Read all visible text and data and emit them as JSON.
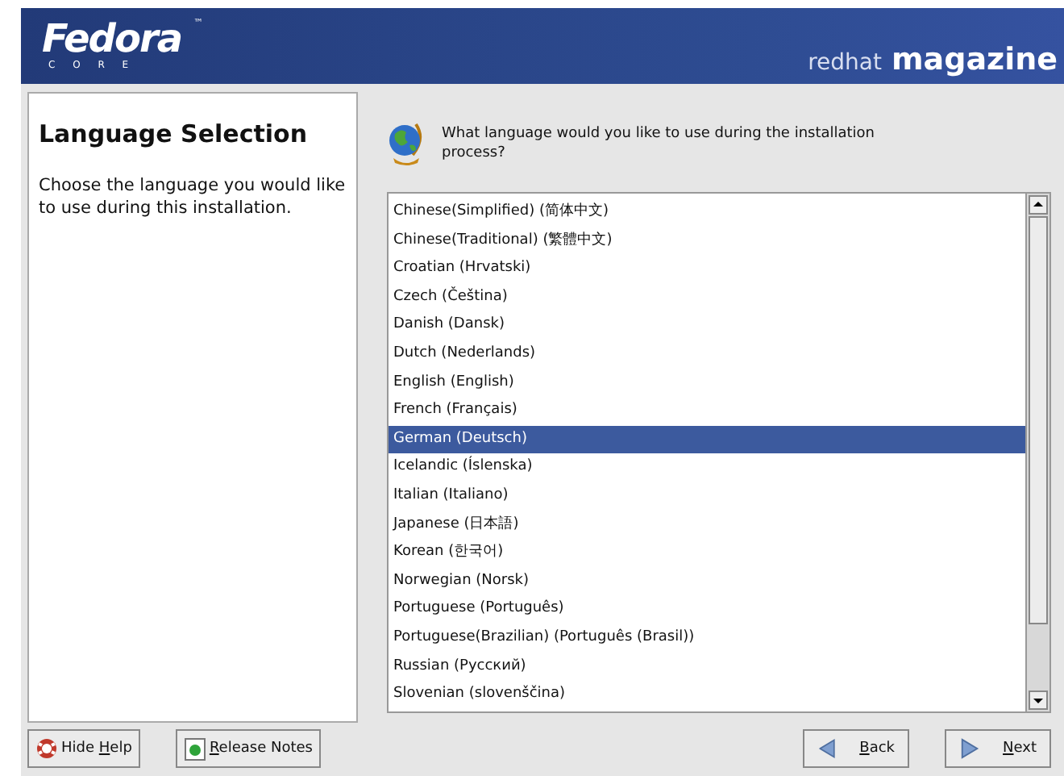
{
  "header": {
    "logo": "Fedora",
    "logo_tm": "™",
    "logo_sub": "C O R E",
    "brand_light": "redhat",
    "brand_bold": "magazine"
  },
  "help": {
    "title": "Language Selection",
    "text": "Choose the language you would like to use during this installation."
  },
  "question": "What language would you like to use during the installation process?",
  "languages": [
    {
      "label": "Chinese(Simplified) (简体中文)",
      "selected": false
    },
    {
      "label": "Chinese(Traditional) (繁體中文)",
      "selected": false
    },
    {
      "label": "Croatian (Hrvatski)",
      "selected": false
    },
    {
      "label": "Czech (Čeština)",
      "selected": false
    },
    {
      "label": "Danish (Dansk)",
      "selected": false
    },
    {
      "label": "Dutch (Nederlands)",
      "selected": false
    },
    {
      "label": "English (English)",
      "selected": false
    },
    {
      "label": "French (Français)",
      "selected": false
    },
    {
      "label": "German (Deutsch)",
      "selected": true
    },
    {
      "label": "Icelandic (Íslenska)",
      "selected": false
    },
    {
      "label": "Italian (Italiano)",
      "selected": false
    },
    {
      "label": "Japanese (日本語)",
      "selected": false
    },
    {
      "label": "Korean (한국어)",
      "selected": false
    },
    {
      "label": "Norwegian (Norsk)",
      "selected": false
    },
    {
      "label": "Portuguese (Português)",
      "selected": false
    },
    {
      "label": "Portuguese(Brazilian) (Português (Brasil))",
      "selected": false
    },
    {
      "label": "Russian (Русский)",
      "selected": false
    },
    {
      "label": "Slovenian (slovenščina)",
      "selected": false
    }
  ],
  "buttons": [
    {
      "kind": "help",
      "before": "Hide ",
      "key": "H",
      "after": "elp"
    },
    {
      "kind": "notes",
      "key": "R",
      "after": "elease Notes"
    },
    {
      "kind": "back",
      "key": "B",
      "after": "ack"
    },
    {
      "kind": "next",
      "key": "N",
      "after": "ext"
    }
  ]
}
